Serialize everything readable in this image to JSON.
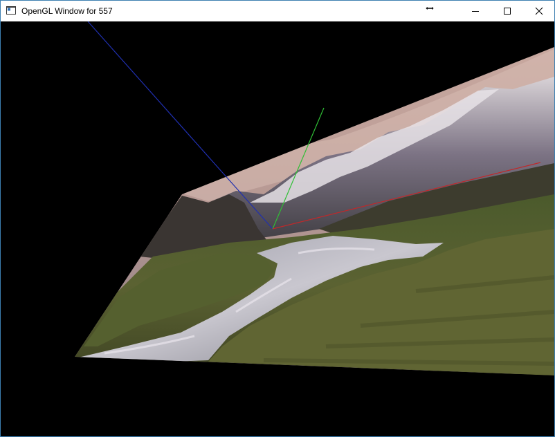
{
  "window": {
    "title": "OpenGL Window for 557",
    "controls": [
      "minimize",
      "maximize",
      "close"
    ]
  },
  "scene": {
    "background": "#000000",
    "axis_colors": {
      "x_axis": "#c0282a",
      "y_axis": "#2fbf35",
      "z_axis": "#1f2fb0"
    },
    "texture": "mountain-valley-river-landscape"
  }
}
